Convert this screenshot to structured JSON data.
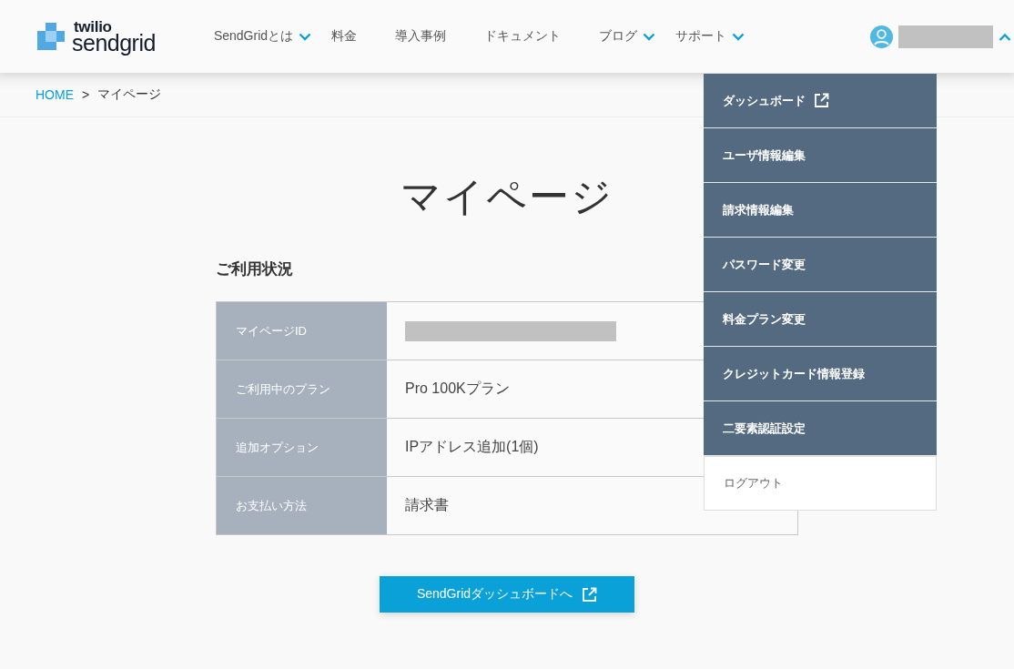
{
  "header": {
    "logo": {
      "line_1": "twilio",
      "line_2": "sendgrid"
    },
    "nav": [
      {
        "label": "SendGridとは",
        "has_dropdown": true
      },
      {
        "label": "料金",
        "has_dropdown": false
      },
      {
        "label": "導入事例",
        "has_dropdown": false
      },
      {
        "label": "ドキュメント",
        "has_dropdown": false
      },
      {
        "label": "ブログ",
        "has_dropdown": true
      },
      {
        "label": "サポート",
        "has_dropdown": true
      }
    ],
    "account": {
      "expanded": true
    }
  },
  "breadcrumb": [
    {
      "label": "HOME",
      "kind": "link"
    },
    {
      "label": ">",
      "kind": "separator"
    },
    {
      "label": "マイページ",
      "kind": "current"
    }
  ],
  "page_title": "マイページ",
  "usage": {
    "heading": "ご利用状況",
    "rows": [
      {
        "label": "マイページID",
        "kind": "redacted"
      },
      {
        "label": "ご利用中のプラン",
        "kind": "text",
        "value": "Pro 100Kプラン"
      },
      {
        "label": "追加オプション",
        "kind": "text",
        "value": "IPアドレス追加(1個)"
      },
      {
        "label": "お支払い方法",
        "kind": "text",
        "value": "請求書"
      }
    ]
  },
  "dashboard_button": {
    "label": "SendGridダッシュボードへ"
  },
  "account_menu": [
    {
      "label": "ダッシュボード",
      "kind": "external"
    },
    {
      "label": "ユーザ情報編集",
      "kind": "link"
    },
    {
      "label": "請求情報編集",
      "kind": "link"
    },
    {
      "label": "パスワード変更",
      "kind": "link"
    },
    {
      "label": "料金プラン変更",
      "kind": "link"
    },
    {
      "label": "クレジットカード情報登録",
      "kind": "link"
    },
    {
      "label": "二要素認証設定",
      "kind": "link"
    },
    {
      "label": "ログアウト",
      "kind": "logout"
    }
  ]
}
